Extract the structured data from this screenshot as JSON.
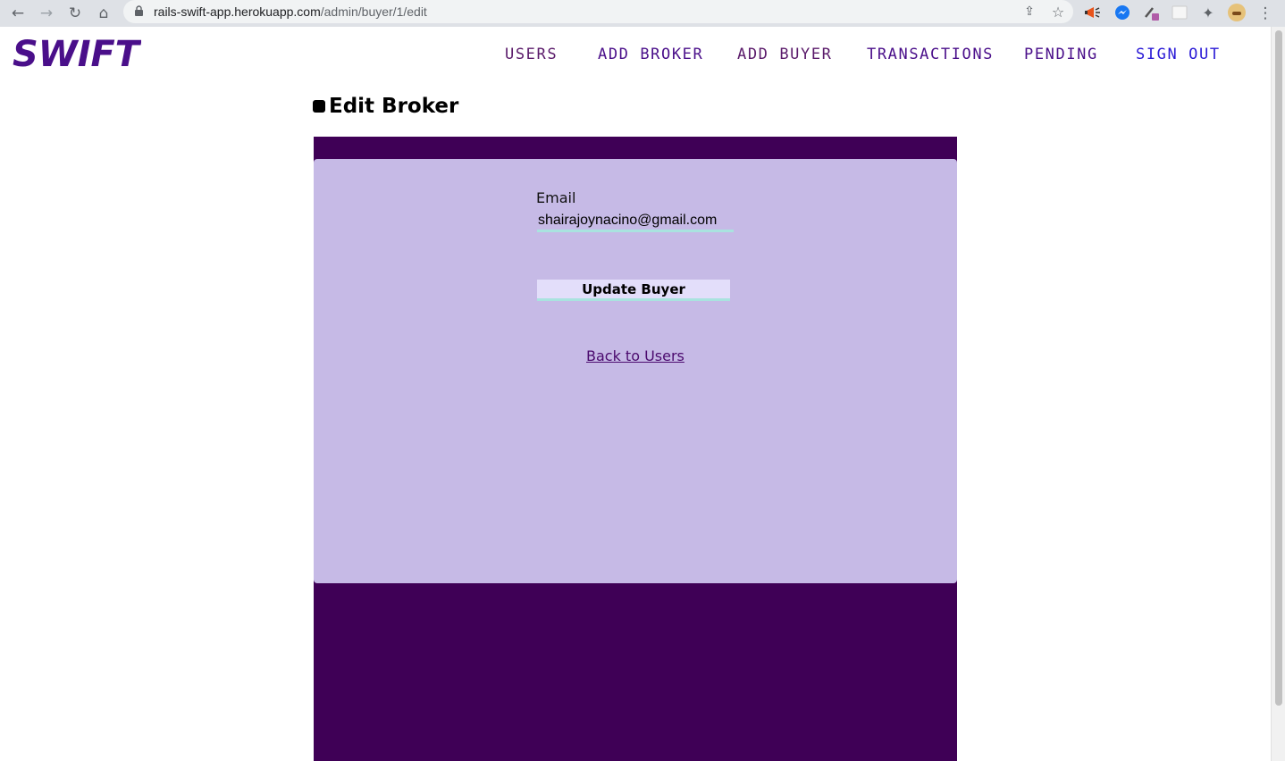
{
  "browser": {
    "url_domain": "rails-swift-app.herokuapp.com",
    "url_path": "/admin/buyer/1/edit",
    "back_icon": "←",
    "forward_icon": "→",
    "reload_icon": "↻",
    "home_icon": "⌂",
    "share_icon": "⇪",
    "bookmark_icon": "☆",
    "menu_icon": "⋮",
    "extensions_icon": "✦"
  },
  "app": {
    "logo_text": "SWIFT"
  },
  "nav": {
    "users": "USERS",
    "add_broker": "ADD BROKER",
    "add_buyer": "ADD BUYER",
    "transactions": "TRANSACTIONS",
    "pending": "PENDING",
    "sign_out": "SIGN OUT"
  },
  "page": {
    "title": "Edit Broker"
  },
  "form": {
    "email_label": "Email",
    "email_value": "shairajoynacino@gmail.com",
    "submit_label": "Update Buyer",
    "back_link": "Back to Users"
  },
  "colors": {
    "panel_dark": "#3f0056",
    "panel_light": "#c6bae6",
    "accent_underline": "#a9e3df",
    "logo": "#4a0f8a"
  }
}
